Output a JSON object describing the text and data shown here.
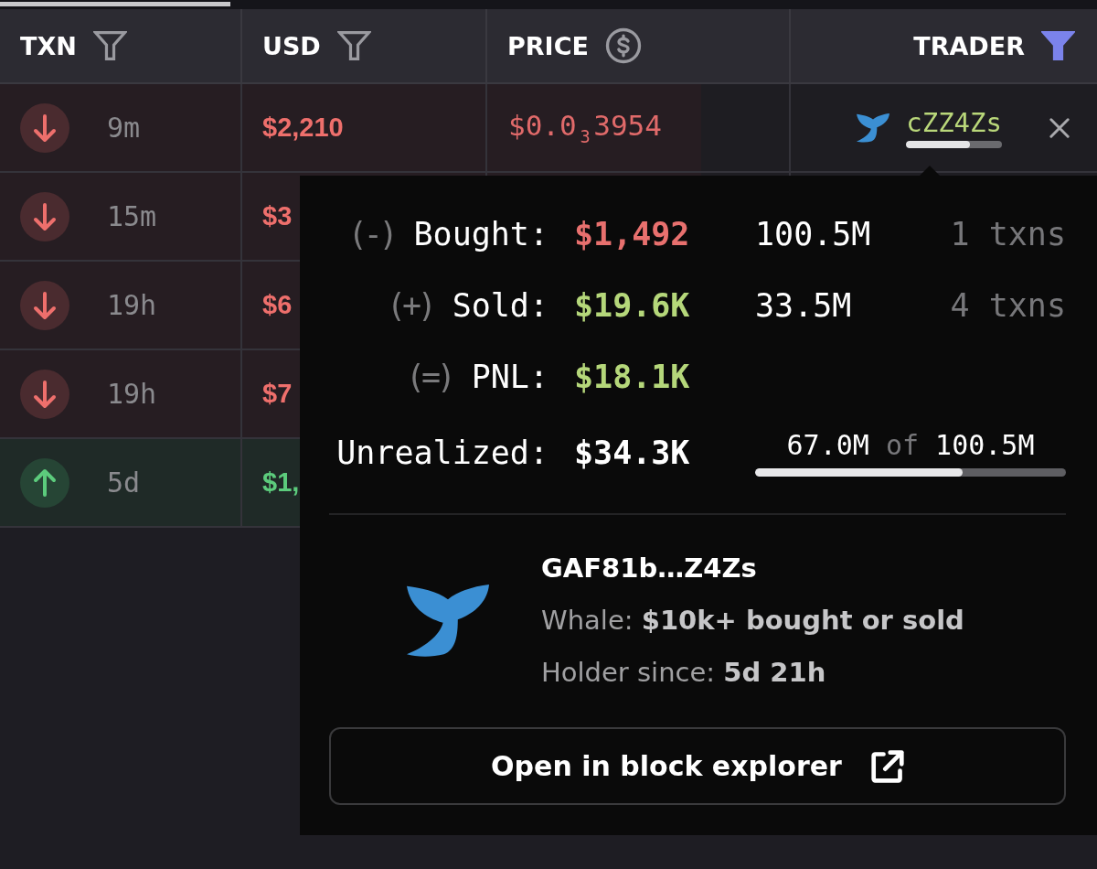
{
  "table": {
    "columns": [
      {
        "label": "TXN",
        "kind": "filter",
        "active": false
      },
      {
        "label": "USD",
        "kind": "filter",
        "active": false
      },
      {
        "label": "PRICE",
        "kind": "currency"
      },
      {
        "label": "TRADER",
        "kind": "filter",
        "active": true
      }
    ],
    "rows": [
      {
        "kind": "sell",
        "age": "9m",
        "usd": "$2,210",
        "price": "$0.0$_{3}$3954",
        "trader": {
          "name": "cZZ4Zs",
          "level": 0.667
        }
      },
      {
        "kind": "sell",
        "age": "15m",
        "usd": "$3"
      },
      {
        "kind": "sell",
        "age": "19h",
        "usd": "$6"
      },
      {
        "kind": "sell",
        "age": "19h",
        "usd": "$7"
      },
      {
        "kind": "buy",
        "age": "5d",
        "usd": "$1,"
      }
    ]
  },
  "trader_popup": {
    "stats": [
      {
        "sign": "(-)",
        "label": "Bought:",
        "value": "$1,492",
        "kind": "loss",
        "amount": "100.5M",
        "txns": "1 txns"
      },
      {
        "sign": "(+)",
        "label": "Sold:",
        "value": "$19.6K",
        "kind": "gain",
        "amount": "33.5M",
        "txns": "4 txns"
      },
      {
        "sign": "(=)",
        "label": "PNL:",
        "value": "$18.1K",
        "kind": "gain"
      },
      {
        "label": "Unrealized:",
        "value": "$34.3K",
        "kind": "neutral",
        "holding": {
          "held": "67.0M",
          "joiner": "of",
          "total": "100.5M",
          "level": 0.667
        }
      }
    ],
    "address": "GAF81b…Z4Zs",
    "info": [
      "Whale: **$10k+ bought or sold**",
      "Holder since: **5d 21h**"
    ],
    "button": "Open in block explorer"
  }
}
